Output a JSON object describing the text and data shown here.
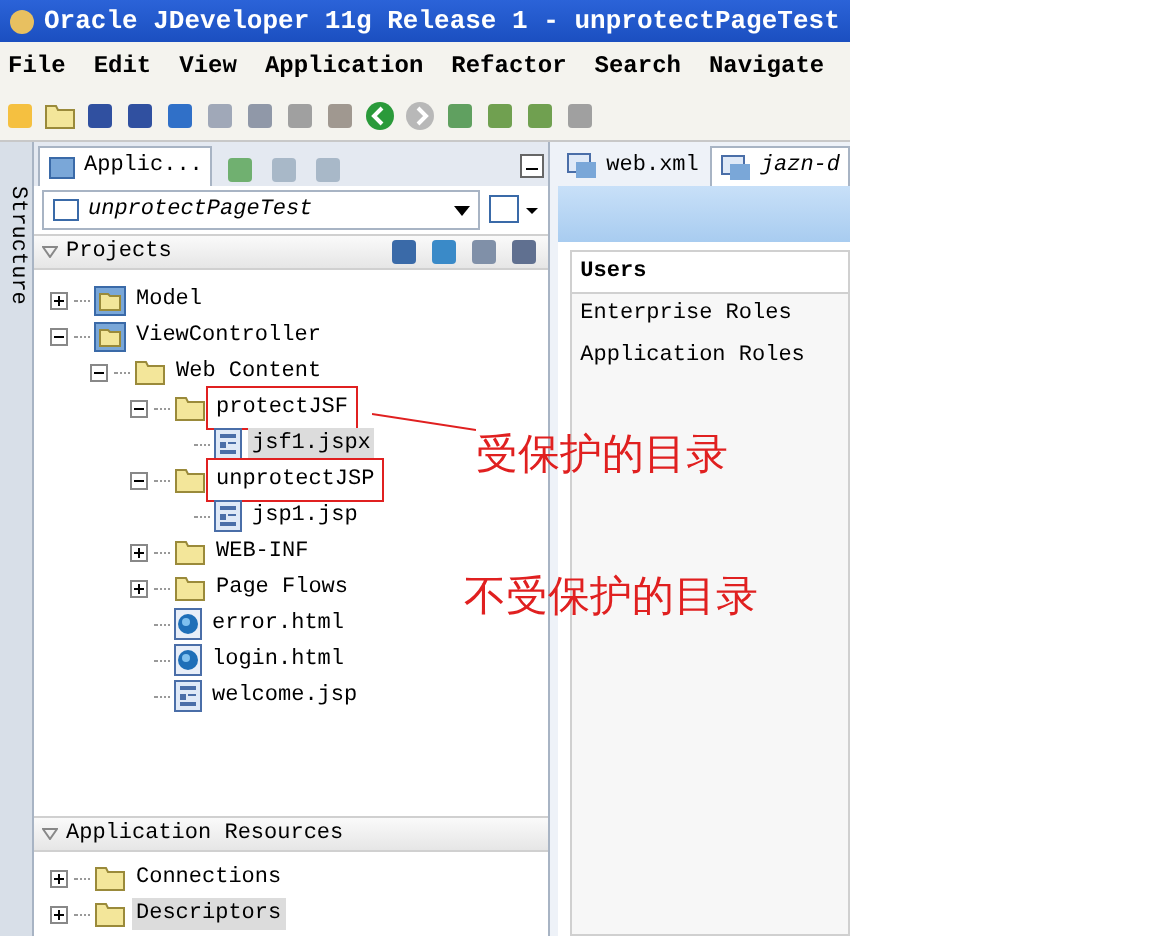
{
  "window": {
    "title": "Oracle JDeveloper 11g Release 1 - unprotectPageTest"
  },
  "menu": [
    {
      "label": "File"
    },
    {
      "label": "Edit"
    },
    {
      "label": "View"
    },
    {
      "label": "Application"
    },
    {
      "label": "Refactor"
    },
    {
      "label": "Search"
    },
    {
      "label": "Navigate"
    }
  ],
  "side_strip": {
    "label": "Structure"
  },
  "left_tabs": [
    {
      "label": "Applic...",
      "selected": true
    }
  ],
  "application_selector": {
    "value": "unprotectPageTest"
  },
  "projects": {
    "title": "Projects",
    "tree": [
      {
        "label": "Model",
        "kind": "project",
        "expanded": false,
        "selected": false,
        "boxed": false
      },
      {
        "label": "ViewController",
        "kind": "project",
        "expanded": true,
        "selected": false,
        "boxed": false,
        "children": [
          {
            "label": "Web Content",
            "kind": "folder",
            "expanded": true,
            "selected": false,
            "boxed": false,
            "children": [
              {
                "label": "protectJSF",
                "kind": "folder",
                "expanded": true,
                "selected": false,
                "boxed": true,
                "children": [
                  {
                    "label": "jsf1.jspx",
                    "kind": "page",
                    "selected": true,
                    "boxed": false
                  }
                ]
              },
              {
                "label": "unprotectJSP",
                "kind": "folder",
                "expanded": true,
                "selected": false,
                "boxed": true,
                "children": [
                  {
                    "label": "jsp1.jsp",
                    "kind": "page",
                    "selected": false,
                    "boxed": false
                  }
                ]
              },
              {
                "label": "WEB-INF",
                "kind": "folder",
                "expanded": false,
                "selected": false,
                "boxed": false
              },
              {
                "label": "Page Flows",
                "kind": "folder",
                "expanded": false,
                "selected": false,
                "boxed": false
              },
              {
                "label": "error.html",
                "kind": "html",
                "selected": false,
                "boxed": false
              },
              {
                "label": "login.html",
                "kind": "html",
                "selected": false,
                "boxed": false
              },
              {
                "label": "welcome.jsp",
                "kind": "page",
                "selected": false,
                "boxed": false
              }
            ]
          }
        ]
      }
    ]
  },
  "application_resources": {
    "title": "Application Resources",
    "tree": [
      {
        "label": "Connections",
        "kind": "folder",
        "expanded": false,
        "selected": false,
        "boxed": false
      },
      {
        "label": "Descriptors",
        "kind": "folder",
        "expanded": false,
        "selected": true,
        "boxed": false
      }
    ]
  },
  "editor_tabs": [
    {
      "label": "web.xml",
      "selected": false
    },
    {
      "label": "jazn-d",
      "selected": true
    }
  ],
  "security_nav": [
    {
      "label": "Users",
      "selected": true
    },
    {
      "label": "Enterprise Roles",
      "selected": false
    },
    {
      "label": "Application Roles",
      "selected": false
    }
  ],
  "annotations": [
    {
      "text": "受保护的目录"
    },
    {
      "text": "不受保护的目录"
    }
  ]
}
